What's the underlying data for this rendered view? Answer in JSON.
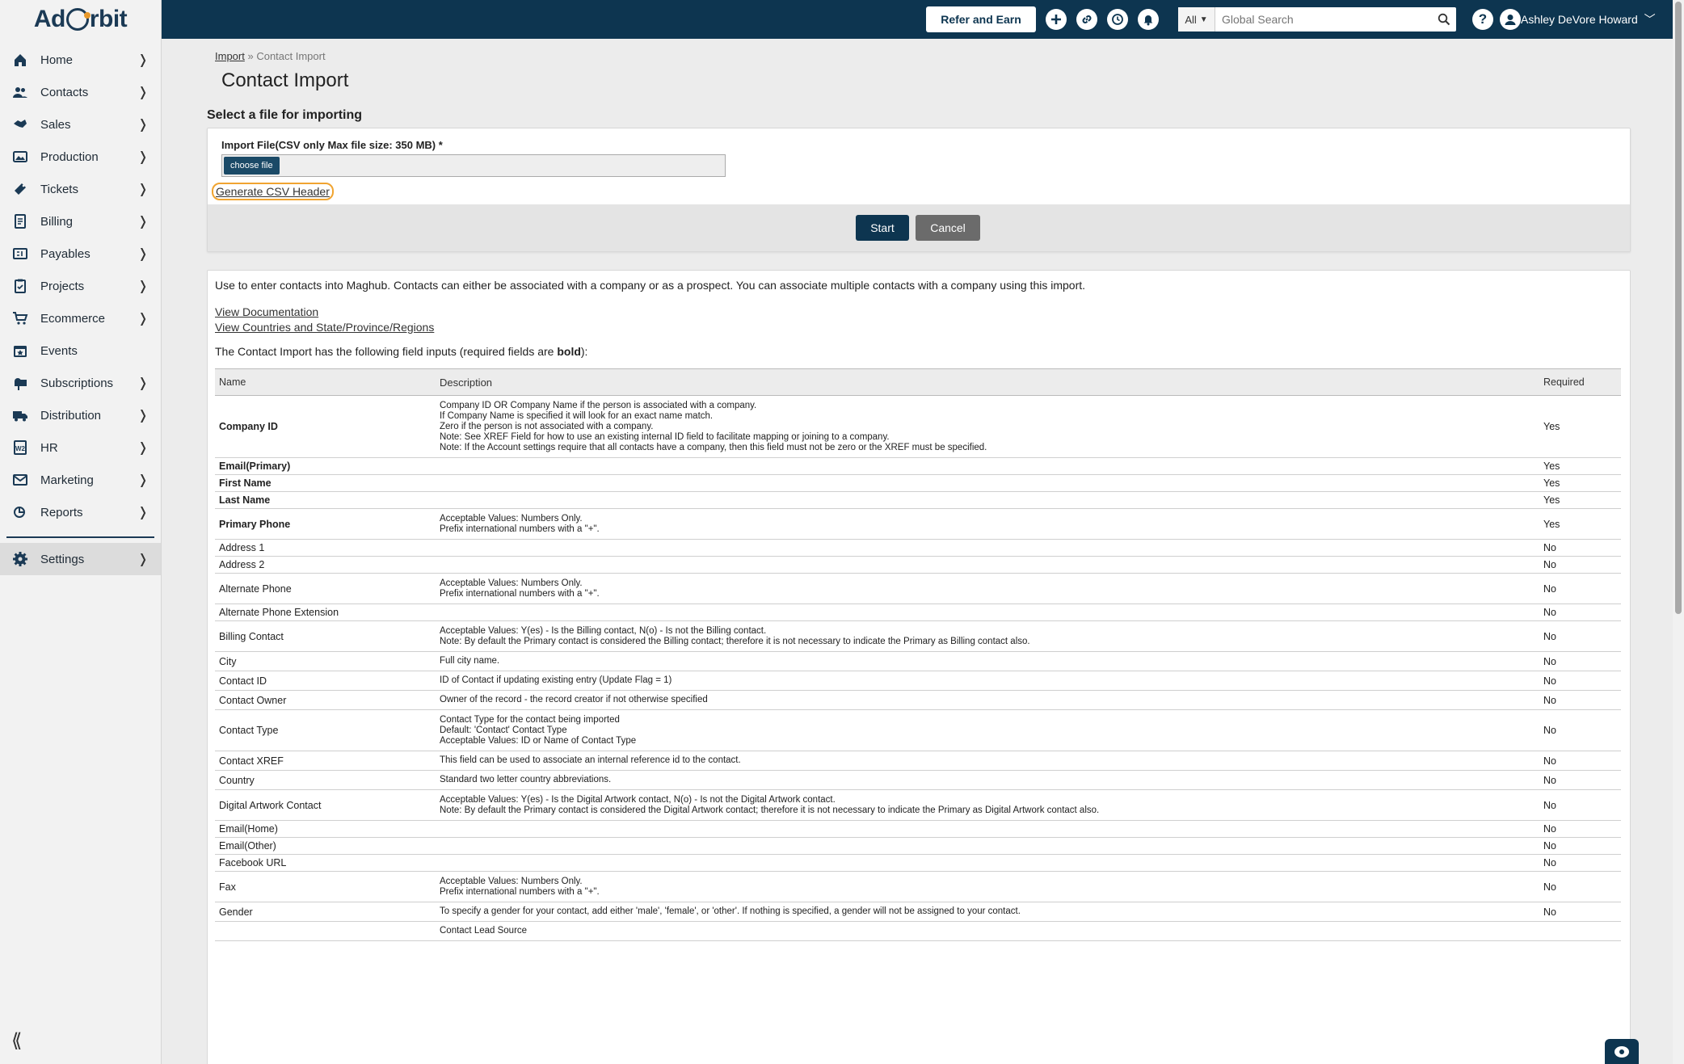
{
  "app": {
    "logo_text_left": "Ad",
    "logo_text_right": "rbit"
  },
  "sidebar": {
    "items": [
      {
        "label": "Home",
        "icon": "home-icon",
        "has_chevron": true
      },
      {
        "label": "Contacts",
        "icon": "contacts-icon",
        "has_chevron": true
      },
      {
        "label": "Sales",
        "icon": "sales-icon",
        "has_chevron": true
      },
      {
        "label": "Production",
        "icon": "production-icon",
        "has_chevron": true
      },
      {
        "label": "Tickets",
        "icon": "tickets-icon",
        "has_chevron": true
      },
      {
        "label": "Billing",
        "icon": "billing-icon",
        "has_chevron": true
      },
      {
        "label": "Payables",
        "icon": "payables-icon",
        "has_chevron": true
      },
      {
        "label": "Projects",
        "icon": "projects-icon",
        "has_chevron": true
      },
      {
        "label": "Ecommerce",
        "icon": "cart-icon",
        "has_chevron": true
      },
      {
        "label": "Events",
        "icon": "calendar-icon",
        "has_chevron": false
      },
      {
        "label": "Subscriptions",
        "icon": "mailbox-icon",
        "has_chevron": true
      },
      {
        "label": "Distribution",
        "icon": "truck-icon",
        "has_chevron": true
      },
      {
        "label": "HR",
        "icon": "hr-icon",
        "has_chevron": true
      },
      {
        "label": "Marketing",
        "icon": "envelope-icon",
        "has_chevron": true
      },
      {
        "label": "Reports",
        "icon": "reports-icon",
        "has_chevron": true
      }
    ],
    "settings": {
      "label": "Settings",
      "icon": "gear-icon"
    },
    "collapse_glyph": "⟪"
  },
  "topbar": {
    "refer_label": "Refer and Earn",
    "search_scope": "All",
    "search_placeholder": "Global Search",
    "user_name": "Ashley DeVore Howard"
  },
  "breadcrumb": {
    "link": "Import",
    "separator": "»",
    "current": "Contact Import"
  },
  "page": {
    "title": "Contact Import",
    "section_title": "Select a file for importing",
    "file_label": "Import File(CSV only Max file size: 350 MB) *",
    "choose_file_label": "choose file",
    "generate_link": "Generate CSV Header",
    "start_label": "Start",
    "cancel_label": "Cancel",
    "intro_text": "Use to enter contacts into Maghub. Contacts can either be associated with a company or as a prospect. You can associate multiple contacts with a company using this import.",
    "doc_link": "View Documentation",
    "countries_link": "View Countries and State/Province/Regions",
    "fields_note_prefix": "The Contact Import has the following field inputs (required fields are ",
    "fields_note_bold": "bold",
    "fields_note_suffix": "):"
  },
  "table": {
    "headers": {
      "name": "Name",
      "description": "Description",
      "required": "Required"
    },
    "rows": [
      {
        "name": "Company ID",
        "required": "Yes",
        "bold": true,
        "desc": [
          "Company ID OR Company Name if the person is associated with a company.",
          "If Company Name is specified it will look for an exact name match.",
          "Zero if the person is not associated with a company.",
          "Note: See XREF Field for how to use an existing internal ID field to facilitate mapping or joining to a company.",
          "Note: If the Account settings require that all contacts have a company, then this field must not be zero or the XREF must be specified."
        ]
      },
      {
        "name": "Email(Primary)",
        "required": "Yes",
        "bold": true,
        "desc": []
      },
      {
        "name": "First Name",
        "required": "Yes",
        "bold": true,
        "desc": []
      },
      {
        "name": "Last Name",
        "required": "Yes",
        "bold": true,
        "desc": []
      },
      {
        "name": "Primary Phone",
        "required": "Yes",
        "bold": true,
        "desc": [
          "Acceptable Values: Numbers Only.",
          "Prefix international numbers with a \"+\"."
        ]
      },
      {
        "name": "Address 1",
        "required": "No",
        "bold": false,
        "desc": []
      },
      {
        "name": "Address 2",
        "required": "No",
        "bold": false,
        "desc": []
      },
      {
        "name": "Alternate Phone",
        "required": "No",
        "bold": false,
        "desc": [
          "Acceptable Values: Numbers Only.",
          "Prefix international numbers with a \"+\"."
        ]
      },
      {
        "name": "Alternate Phone Extension",
        "required": "No",
        "bold": false,
        "desc": []
      },
      {
        "name": "Billing Contact",
        "required": "No",
        "bold": false,
        "desc": [
          "Acceptable Values: Y(es) - Is the Billing contact, N(o) - Is not the Billing contact.",
          "Note: By default the Primary contact is considered the Billing contact; therefore it is not necessary to indicate the Primary as Billing contact also."
        ]
      },
      {
        "name": "City",
        "required": "No",
        "bold": false,
        "desc": [
          "Full city name."
        ]
      },
      {
        "name": "Contact ID",
        "required": "No",
        "bold": false,
        "desc": [
          "ID of Contact if updating existing entry (Update Flag = 1)"
        ]
      },
      {
        "name": "Contact Owner",
        "required": "No",
        "bold": false,
        "desc": [
          "Owner of the record - the record creator if not otherwise specified"
        ]
      },
      {
        "name": "Contact Type",
        "required": "No",
        "bold": false,
        "desc": [
          "Contact Type for the contact being imported",
          "Default: 'Contact' Contact Type",
          "Acceptable Values: ID or Name of Contact Type"
        ]
      },
      {
        "name": "Contact XREF",
        "required": "No",
        "bold": false,
        "desc": [
          "This field can be used to associate an internal reference id to the contact."
        ]
      },
      {
        "name": "Country",
        "required": "No",
        "bold": false,
        "desc": [
          "Standard two letter country abbreviations."
        ]
      },
      {
        "name": "Digital Artwork Contact",
        "required": "No",
        "bold": false,
        "desc": [
          "Acceptable Values: Y(es) - Is the Digital Artwork contact, N(o) - Is not the Digital Artwork contact.",
          "Note: By default the Primary contact is considered the Digital Artwork contact; therefore it is not necessary to indicate the Primary as Digital Artwork contact also."
        ]
      },
      {
        "name": "Email(Home)",
        "required": "No",
        "bold": false,
        "desc": []
      },
      {
        "name": "Email(Other)",
        "required": "No",
        "bold": false,
        "desc": []
      },
      {
        "name": "Facebook URL",
        "required": "No",
        "bold": false,
        "desc": []
      },
      {
        "name": "Fax",
        "required": "No",
        "bold": false,
        "desc": [
          "Acceptable Values: Numbers Only.",
          "Prefix international numbers with a \"+\"."
        ]
      },
      {
        "name": "Gender",
        "required": "No",
        "bold": false,
        "desc": [
          "To specify a gender for your contact, add either 'male', 'female', or 'other'. If nothing is specified, a gender will not be assigned to your contact."
        ]
      },
      {
        "name": "",
        "required": "",
        "bold": false,
        "desc": [
          "Contact Lead Source"
        ]
      }
    ]
  },
  "colors": {
    "brand_navy": "#0d3550",
    "accent_orange": "#f0a431"
  }
}
